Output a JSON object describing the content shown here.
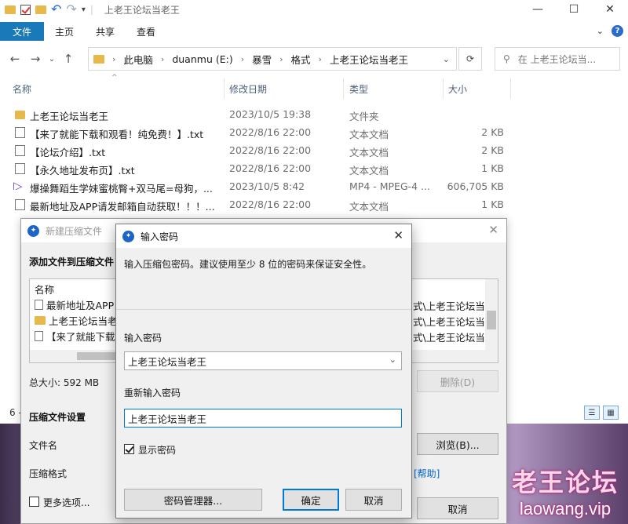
{
  "explorer": {
    "title": "上老王论坛当老王",
    "ribbon_tabs": [
      "文件",
      "主页",
      "共享",
      "查看"
    ],
    "address": {
      "crumbs": [
        "此电脑",
        "duanmu (E:)",
        "暴雪",
        "格式",
        "上老王论坛当老王"
      ]
    },
    "search_placeholder": "在 上老王论坛当...",
    "columns": [
      "名称",
      "修改日期",
      "类型",
      "大小"
    ],
    "files": [
      {
        "name": "上老王论坛当老王",
        "date": "2023/10/5 19:38",
        "type": "文件夹",
        "size": "",
        "icon": "folder-icon"
      },
      {
        "name": "【来了就能下载和观看！纯免费！】.txt",
        "date": "2022/8/16 22:00",
        "type": "文本文档",
        "size": "2 KB",
        "icon": "document-icon"
      },
      {
        "name": "【论坛介绍】.txt",
        "date": "2022/8/16 22:00",
        "type": "文本文档",
        "size": "2 KB",
        "icon": "document-icon"
      },
      {
        "name": "【永久地址发布页】.txt",
        "date": "2022/8/16 22:00",
        "type": "文本文档",
        "size": "1 KB",
        "icon": "document-icon"
      },
      {
        "name": "爆操舞蹈生学妹蜜桃臀+双马尾=母狗，...",
        "date": "2023/10/5 8:42",
        "type": "MP4 - MPEG-4 ...",
        "size": "606,705 KB",
        "icon": "video-icon"
      },
      {
        "name": "最新地址及APP请发邮箱自动获取！！！...",
        "date": "2022/8/16 22:00",
        "type": "文本文档",
        "size": "1 KB",
        "icon": "document-icon"
      }
    ],
    "item_count": "6 -",
    "accent_color": "#1a79b9"
  },
  "compress_dialog": {
    "title": "新建压缩文件",
    "add_files_label": "添加文件到压缩文件",
    "list_header": "名称",
    "list_items": [
      {
        "name": "最新地址及APP",
        "path": "式\\上老王论坛当"
      },
      {
        "name": "上老王论坛当老",
        "path": "式\\上老王论坛当"
      },
      {
        "name": "【来了就能下载",
        "path": "式\\上老王论坛当"
      }
    ],
    "total_size": "总大小: 592 MB",
    "delete_button": "删除(D)",
    "settings_label": "压缩文件设置",
    "filename_label": "文件名",
    "format_label": "压缩格式",
    "browse_button": "浏览(B)...",
    "help_link": "[帮助]",
    "more_options": "更多选项...",
    "cancel_button": "取消"
  },
  "password_dialog": {
    "title": "输入密码",
    "description": "输入压缩包密码。建议使用至少 8 位的密码来保证安全性。",
    "password_label": "输入密码",
    "password_value": "上老王论坛当老王",
    "reenter_label": "重新输入密码",
    "reenter_value": "上老王论坛当老王",
    "show_password_label": "显示密码",
    "show_password_checked": true,
    "manager_button": "密码管理器...",
    "ok_button": "确定",
    "cancel_button": "取消"
  },
  "watermark": {
    "line1": "老王论坛",
    "line2": "laowang.vip"
  }
}
